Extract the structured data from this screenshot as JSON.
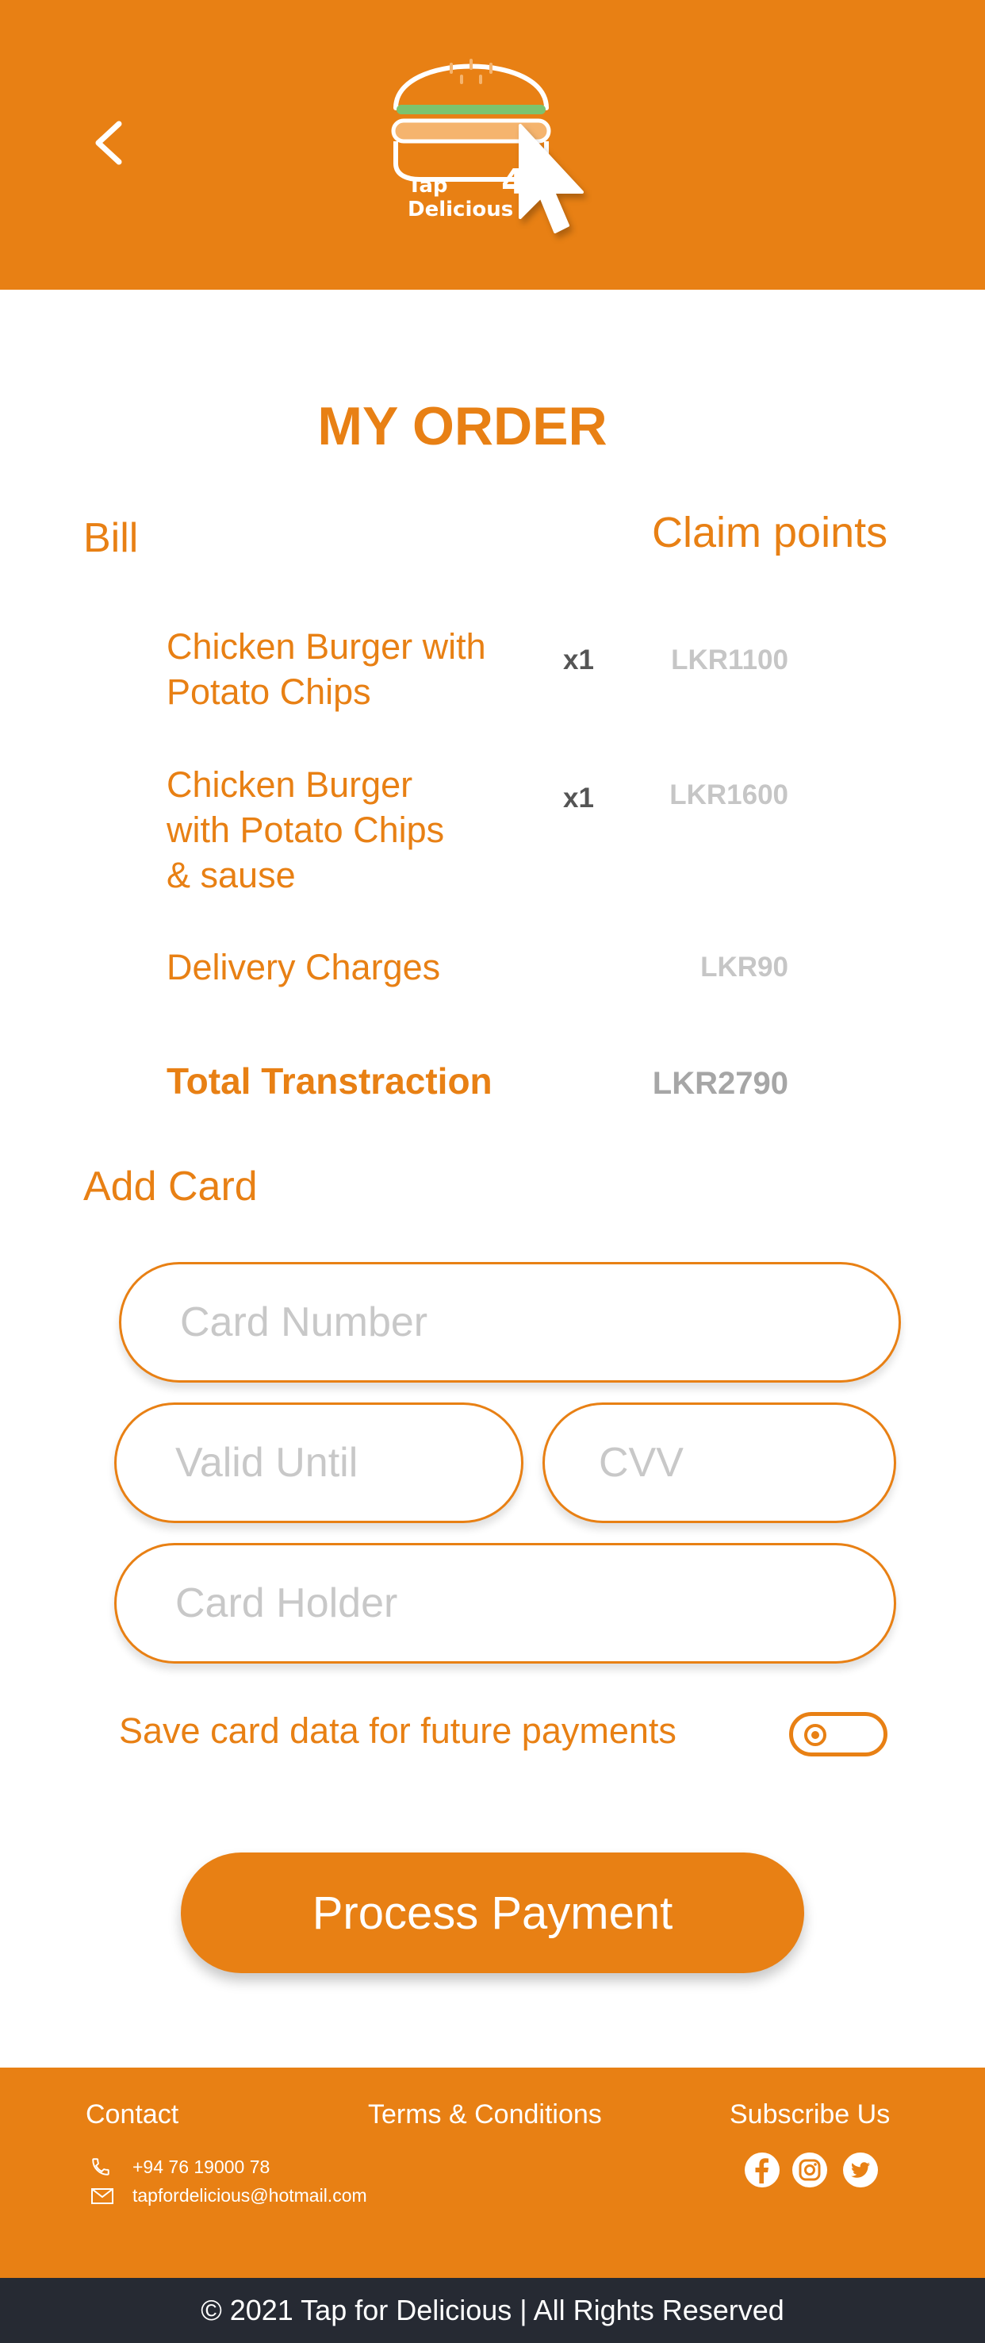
{
  "header": {
    "logo_line1": "Tap",
    "logo_line2": "Delicious",
    "logo_number": "4",
    "back_icon": "chevron-left-icon",
    "bg_color": "#e88014"
  },
  "page": {
    "title": "MY ORDER",
    "bill_label": "Bill",
    "claim_points": "Claim points"
  },
  "order": {
    "items": [
      {
        "name_lines": [
          "Chicken Burger with",
          "Potato Chips"
        ],
        "qty": "x1",
        "price": "LKR1100"
      },
      {
        "name_lines": [
          "Chicken Burger",
          "with Potato Chips",
          "& sause"
        ],
        "qty": "x1",
        "price": "LKR1600"
      }
    ],
    "delivery": {
      "name": "Delivery Charges",
      "price": "LKR90"
    },
    "total": {
      "name": "Total Transtraction",
      "price": "LKR2790"
    }
  },
  "card": {
    "heading": "Add Card",
    "number_placeholder": "Card Number",
    "valid_placeholder": "Valid Until",
    "cvv_placeholder": "CVV",
    "holder_placeholder": "Card Holder",
    "save_label": "Save card data for future payments",
    "save_enabled": false
  },
  "actions": {
    "pay_label": "Process Payment"
  },
  "footer": {
    "contact_heading": "Contact",
    "terms": "Terms & Conditions",
    "subscribe": "Subscribe Us",
    "phone": "+94 76 19000 78",
    "email": "tapfordelicious@hotmail.com",
    "social_icons": [
      "facebook-icon",
      "instagram-icon",
      "twitter-icon"
    ],
    "copyright": "© 2021 Tap for Delicious | All Rights Reserved"
  },
  "colors": {
    "accent": "#e88014",
    "footer_dark": "#262a33",
    "placeholder": "#c8c8c8"
  }
}
